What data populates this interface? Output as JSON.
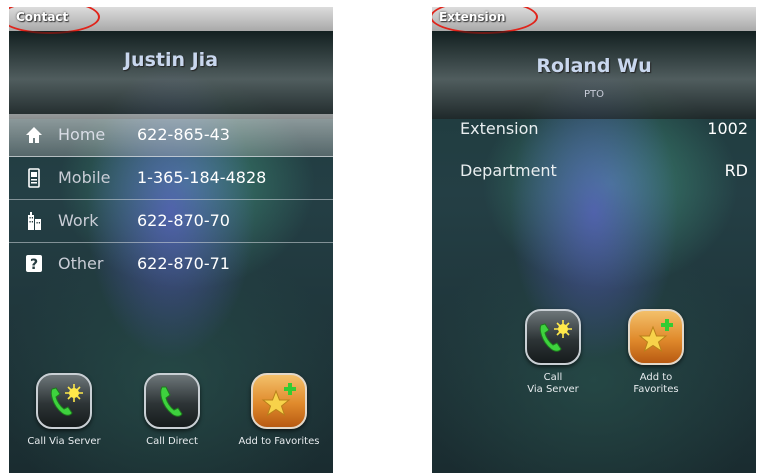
{
  "contact_screen": {
    "status_label": "Contact",
    "name": "Justin Jia",
    "phones": [
      {
        "type": "Home",
        "number": "622-865-43",
        "icon": "home-icon"
      },
      {
        "type": "Mobile",
        "number": "1-365-184-4828",
        "icon": "mobile-phone-icon"
      },
      {
        "type": "Work",
        "number": "622-870-70",
        "icon": "building-icon"
      },
      {
        "type": "Other",
        "number": "622-870-71",
        "icon": "question-mark-icon"
      }
    ],
    "actions": [
      {
        "label": "Call Via Server",
        "icon": "phone-server-icon"
      },
      {
        "label": "Call Direct",
        "icon": "phone-icon"
      },
      {
        "label": "Add to Favorites",
        "icon": "star-add-icon"
      }
    ]
  },
  "extension_screen": {
    "status_label": "Extension",
    "name": "Roland Wu",
    "subtitle": "PTO",
    "fields": [
      {
        "label": "Extension",
        "value": "1002"
      },
      {
        "label": "Department",
        "value": "RD"
      }
    ],
    "actions": [
      {
        "label_line1": "Call",
        "label_line2": "Via Server",
        "icon": "phone-server-icon"
      },
      {
        "label_line1": "Add to",
        "label_line2": "Favorites",
        "icon": "star-add-icon"
      }
    ]
  },
  "colors": {
    "highlight_ring": "#e0241b",
    "name_text": "#c9d7ee"
  }
}
